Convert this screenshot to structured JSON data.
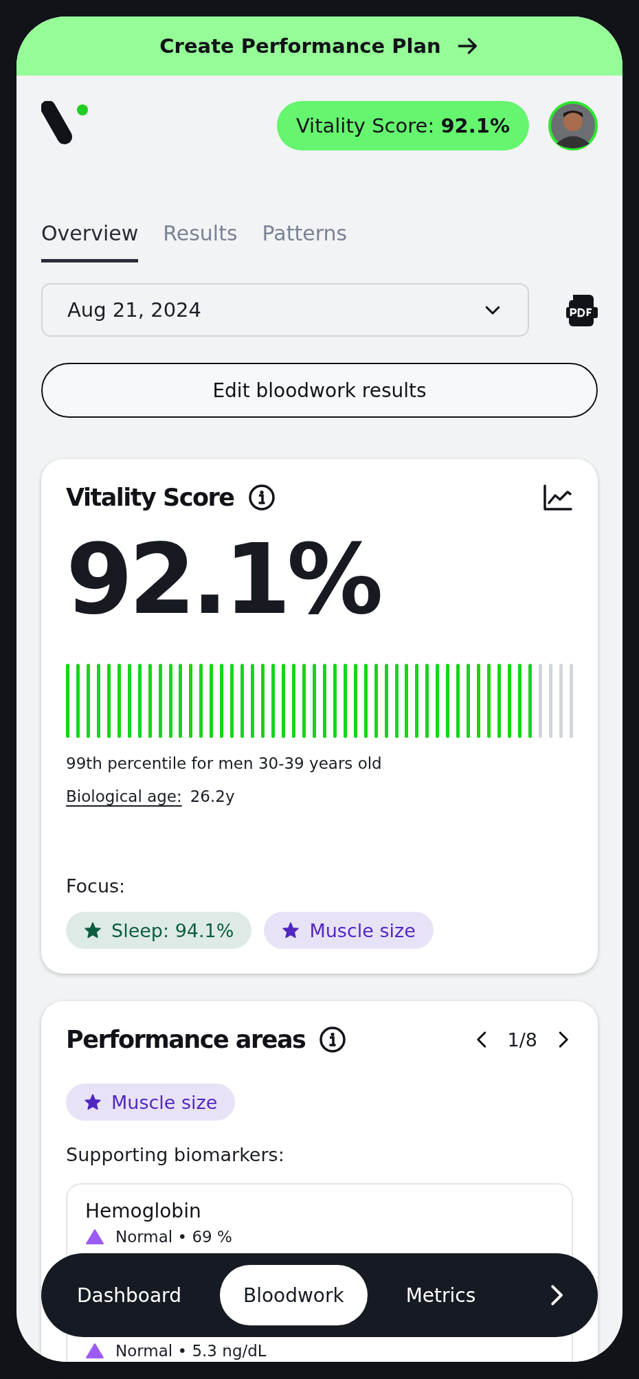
{
  "banner": {
    "label": "Create Performance Plan"
  },
  "header": {
    "score_pill": {
      "label": "Vitality Score: ",
      "value": "92.1%"
    }
  },
  "tabs": [
    {
      "label": "Overview",
      "selected": true
    },
    {
      "label": "Results",
      "selected": false
    },
    {
      "label": "Patterns",
      "selected": false
    }
  ],
  "date_select": {
    "value": "Aug 21, 2024"
  },
  "edit_button": {
    "label": "Edit bloodwork results"
  },
  "vitality_card": {
    "title": "Vitality Score",
    "score": "92.1%",
    "level": 0.921,
    "percentile": "99th percentile for men 30-39 years old",
    "bio_age_label": "Biological age:",
    "bio_age_value": "26.2y",
    "focus_label": "Focus:",
    "focus_tags": [
      {
        "label": "Sleep: 94.1%",
        "color": "#0b5e3f"
      },
      {
        "label": "Muscle size",
        "color": "#5127c2"
      }
    ]
  },
  "performance_card": {
    "title": "Performance areas",
    "pager": "1/8",
    "tag": {
      "label": "Muscle size",
      "color": "#5127c2"
    },
    "supporting_label": "Supporting biomarkers:",
    "biomarkers": [
      {
        "name": "Hemoglobin",
        "status": "Normal",
        "separator": "•",
        "value": "69 %"
      },
      {
        "status": "Normal",
        "separator": "•",
        "value": "5.3 ng/dL"
      }
    ]
  },
  "bottom_nav": [
    {
      "label": "Dashboard",
      "selected": false
    },
    {
      "label": "Bloodwork",
      "selected": true
    },
    {
      "label": "Metrics",
      "selected": false
    }
  ]
}
